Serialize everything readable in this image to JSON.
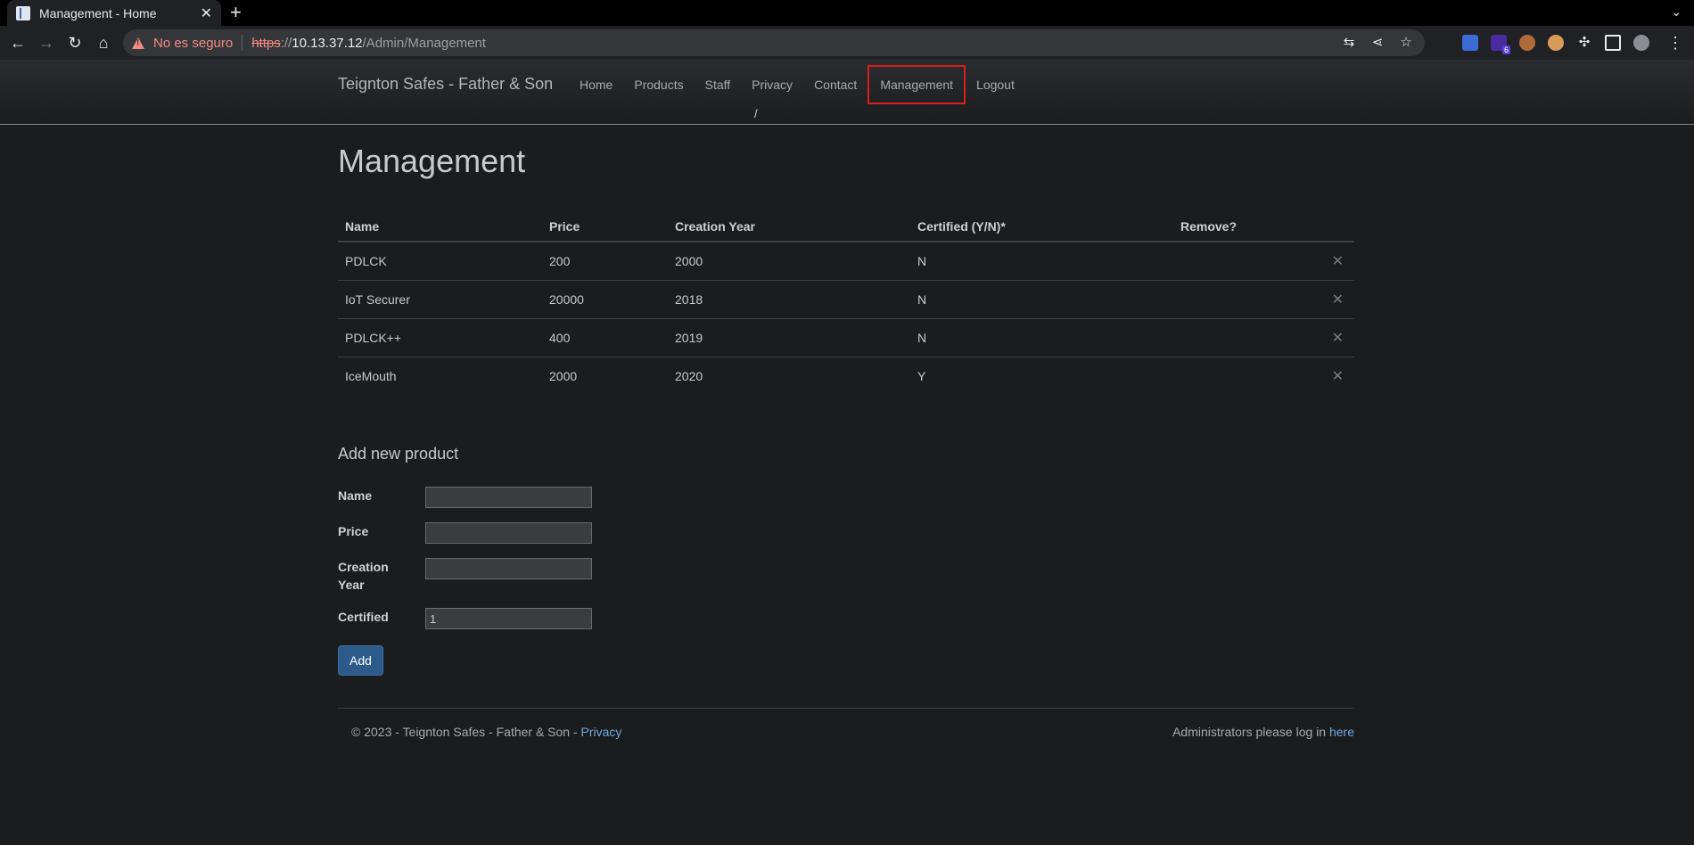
{
  "browser": {
    "tab_title": "Management - Home",
    "insecure_label": "No es seguro",
    "url_scheme": "https",
    "url_sep": "://",
    "url_host": "10.13.37.12",
    "url_path": "/Admin/Management",
    "extension_badge": "6"
  },
  "site": {
    "brand": "Teignton Safes - Father & Son",
    "nav": [
      "Home",
      "Products",
      "Staff",
      "Privacy",
      "Contact",
      "Management",
      "Logout"
    ],
    "nav_active": "Management",
    "breadcrumb": "/"
  },
  "page": {
    "title": "Management",
    "table": {
      "headers": [
        "Name",
        "Price",
        "Creation Year",
        "Certified (Y/N)*",
        "Remove?"
      ],
      "rows": [
        [
          "PDLCK",
          "200",
          "2000",
          "N"
        ],
        [
          "IoT Securer",
          "20000",
          "2018",
          "N"
        ],
        [
          "PDLCK++",
          "400",
          "2019",
          "N"
        ],
        [
          "IceMouth",
          "2000",
          "2020",
          "Y"
        ]
      ],
      "remove_glyph": "✕"
    },
    "form": {
      "heading": "Add new product",
      "name_label": "Name",
      "price_label": "Price",
      "year_label": "Creation Year",
      "certified_label": "Certified",
      "certified_value": "1",
      "submit_label": "Add"
    }
  },
  "footer": {
    "copyright": "© 2023 - Teignton Safes - Father & Son - ",
    "privacy_link": "Privacy",
    "admin_text": "Administrators please log in ",
    "admin_link": "here"
  },
  "colors": {
    "page_bg": "#1b1c1e",
    "active_nav_border": "#d61f1f",
    "link": "#6fa8dc",
    "button": "#2c5a8a"
  }
}
